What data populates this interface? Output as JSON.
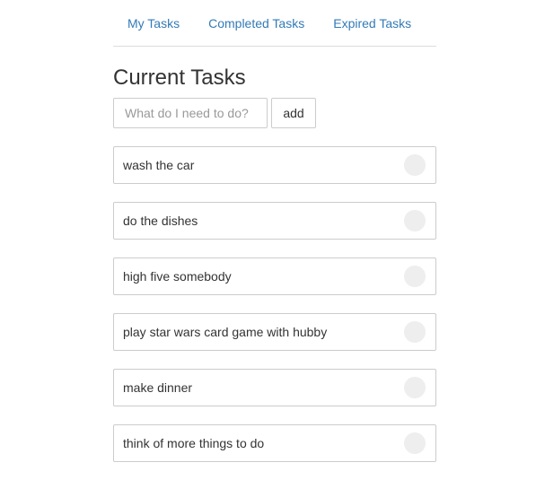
{
  "nav": {
    "items": [
      {
        "label": "My Tasks"
      },
      {
        "label": "Completed Tasks"
      },
      {
        "label": "Expired Tasks"
      }
    ]
  },
  "page_title": "Current Tasks",
  "new_task": {
    "placeholder": "What do I need to do?",
    "value": "",
    "add_label": "add"
  },
  "tasks": [
    {
      "label": "wash the car",
      "completed": false
    },
    {
      "label": "do the dishes",
      "completed": false
    },
    {
      "label": "high five somebody",
      "completed": false
    },
    {
      "label": "play star wars card game with hubby",
      "completed": false
    },
    {
      "label": "make dinner",
      "completed": false
    },
    {
      "label": "think of more things to do",
      "completed": false
    }
  ]
}
